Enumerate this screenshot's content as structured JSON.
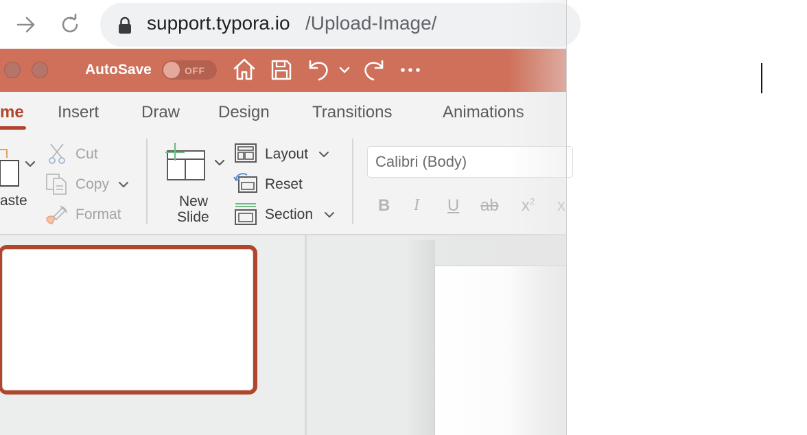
{
  "browser": {
    "url_host": "support.typora.io",
    "url_path": "/Upload-Image/",
    "icons": [
      "forward-arrow-icon",
      "reload-icon",
      "lock-icon"
    ]
  },
  "titlebar": {
    "autosave_label": "AutoSave",
    "autosave_state": "OFF",
    "icons": [
      "home-icon",
      "save-icon",
      "undo-icon",
      "chevron-down-icon",
      "redo-icon",
      "more-icon"
    ]
  },
  "ribbon": {
    "tabs": [
      "me",
      "Insert",
      "Draw",
      "Design",
      "Transitions",
      "Animations"
    ],
    "active_tab": "me",
    "clipboard": {
      "paste_label": "aste",
      "cut_label": "Cut",
      "copy_label": "Copy",
      "format_label": "Format"
    },
    "slides": {
      "new_slide_line1": "New",
      "new_slide_line2": "Slide",
      "layout_label": "Layout",
      "reset_label": "Reset",
      "section_label": "Section"
    },
    "font": {
      "font_name": "Calibri (Body)",
      "bold": "B",
      "italic": "I",
      "underline": "U",
      "strikethrough": "ab",
      "superscript": "x",
      "superscript_exp": "2",
      "subscript": "x"
    }
  },
  "colors": {
    "accent": "#b2462d",
    "titlebar": "#cf705a",
    "ribbon_bg": "#f3f3f3"
  }
}
